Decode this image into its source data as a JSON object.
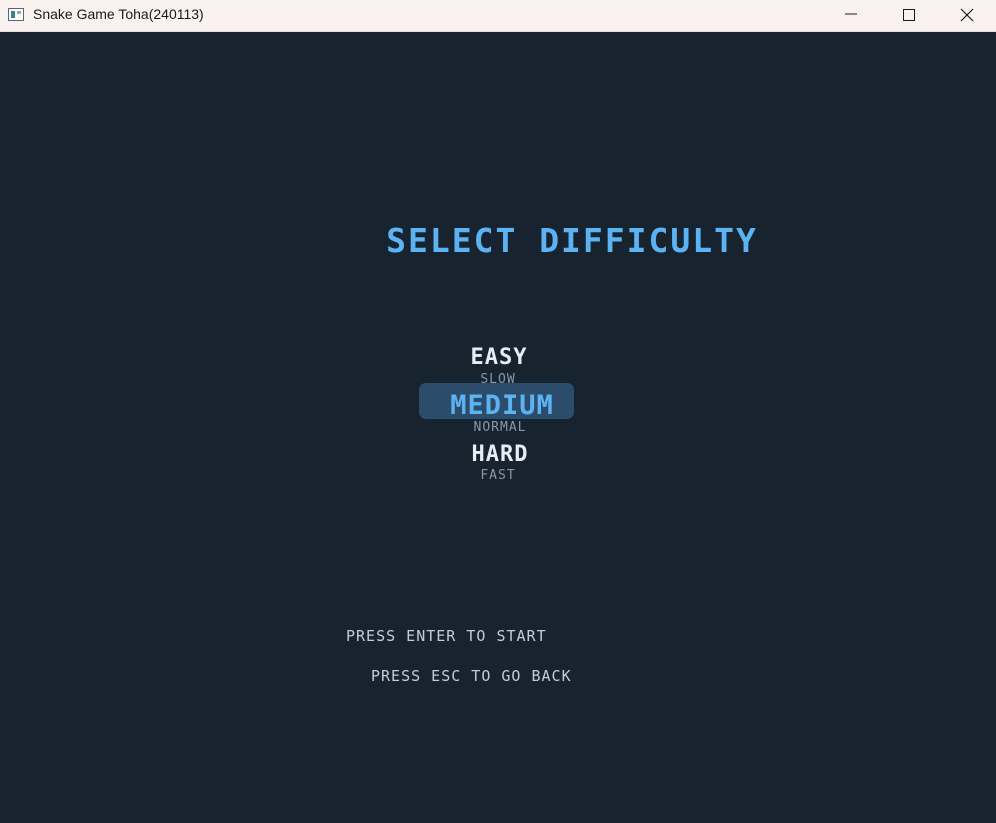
{
  "window": {
    "title": "Snake Game Toha(240113)",
    "controls": [
      "minimize-icon",
      "maximize-icon",
      "close-icon"
    ]
  },
  "menu": {
    "heading": "SELECT DIFFICULTY",
    "selected": "MEDIUM",
    "options": [
      {
        "label": "EASY",
        "speed": "SLOW"
      },
      {
        "label": "MEDIUM",
        "speed": "NORMAL"
      },
      {
        "label": "HARD",
        "speed": "FAST"
      }
    ]
  },
  "hints": {
    "start": "PRESS ENTER TO START",
    "back": "PRESS ESC TO GO BACK"
  },
  "colors": {
    "background": "#182330",
    "accent": "#5cb3f1",
    "highlight": "#2b4d6b",
    "text": "#e7edf3",
    "subtext": "#8b97a5",
    "titlebar": "#f9f1ef"
  }
}
